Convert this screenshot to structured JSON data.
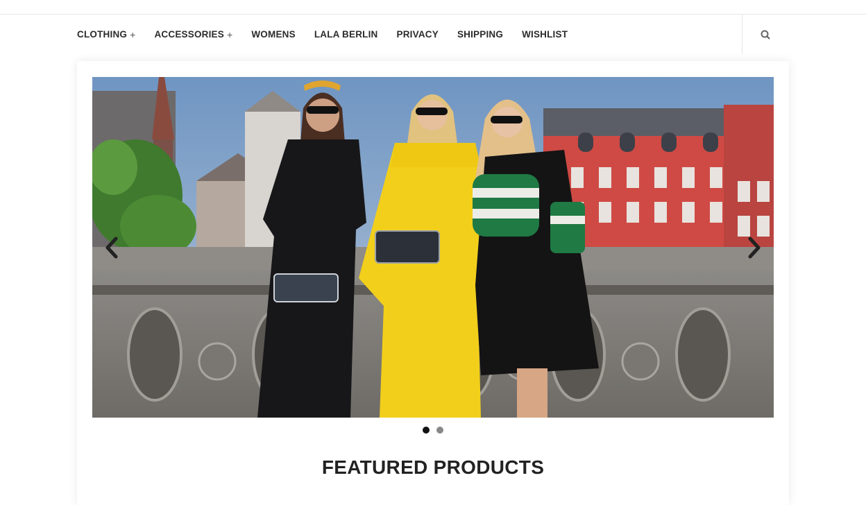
{
  "nav": {
    "items": [
      {
        "label": "CLOTHING",
        "expand": "+"
      },
      {
        "label": "ACCESSORIES",
        "expand": "+"
      },
      {
        "label": "WOMENS"
      },
      {
        "label": "LALA BERLIN"
      },
      {
        "label": "PRIVACY"
      },
      {
        "label": "SHIPPING"
      },
      {
        "label": "WISHLIST"
      }
    ],
    "search_icon": "search-icon"
  },
  "slider": {
    "icons": {
      "prev": "chevron-left-icon",
      "next": "chevron-right-icon"
    },
    "slide_count": 2,
    "active_slide": 1
  },
  "section": {
    "title": "FEATURED PRODUCTS"
  },
  "colors": {
    "text": "#2b2b2b",
    "dot_active": "#111111",
    "dot_inactive": "#888888"
  }
}
